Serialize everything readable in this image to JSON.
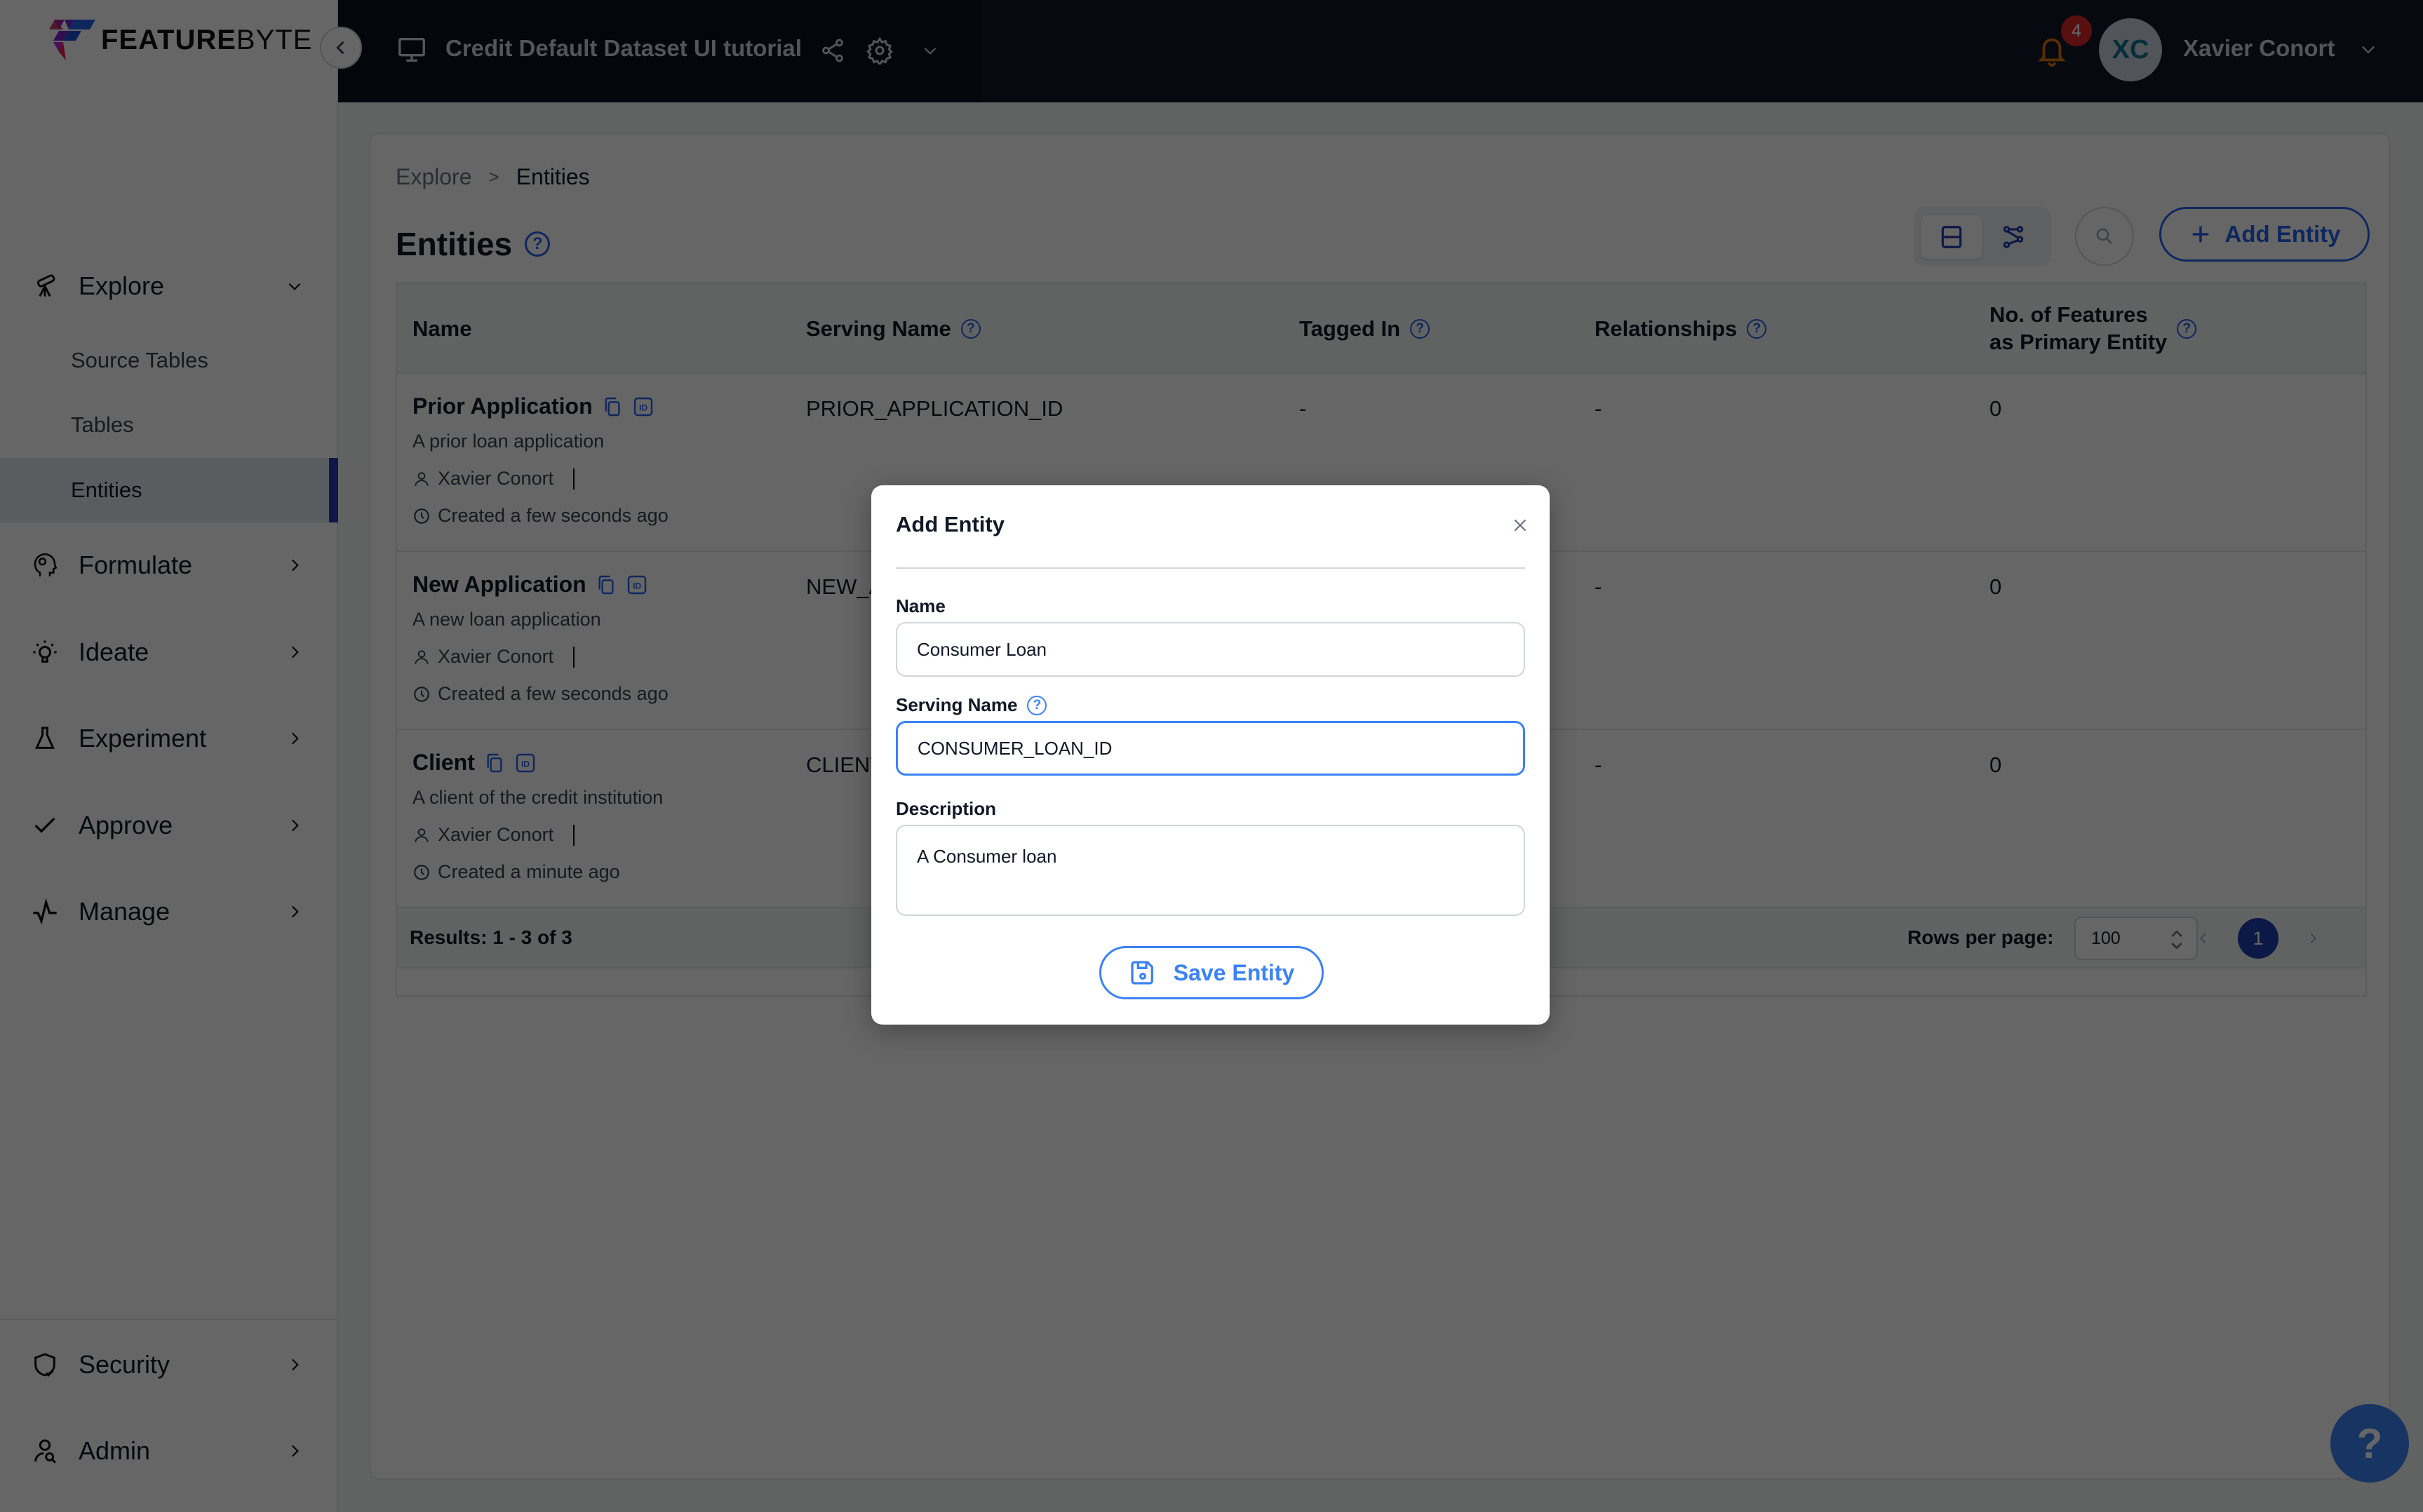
{
  "app": {
    "logo_bold": "FEATURE",
    "logo_light": "BYTE",
    "project_title": "Credit Default Dataset UI tutorial",
    "notification_count": "4",
    "user_initials": "XC",
    "user_name": "Xavier Conort"
  },
  "sidebar": {
    "groups": [
      {
        "label": "Explore",
        "icon": "telescope-icon",
        "expanded": true,
        "items": [
          {
            "label": "Source Tables"
          },
          {
            "label": "Tables"
          },
          {
            "label": "Entities",
            "active": true
          }
        ]
      },
      {
        "label": "Formulate",
        "icon": "head-gear-icon"
      },
      {
        "label": "Ideate",
        "icon": "lightbulb-icon"
      },
      {
        "label": "Experiment",
        "icon": "flask-icon"
      },
      {
        "label": "Approve",
        "icon": "check-icon"
      },
      {
        "label": "Manage",
        "icon": "pulse-icon"
      }
    ],
    "bottom": [
      {
        "label": "Security",
        "icon": "shield-check-icon"
      },
      {
        "label": "Admin",
        "icon": "user-search-icon"
      }
    ]
  },
  "breadcrumb": [
    "Explore",
    "Entities"
  ],
  "page": {
    "title": "Entities",
    "add_button_label": "Add Entity"
  },
  "table": {
    "columns": [
      {
        "label": "Name"
      },
      {
        "label": "Serving Name"
      },
      {
        "label": "Tagged In"
      },
      {
        "label": "Relationships"
      },
      {
        "label": "No. of Features",
        "label2": "as Primary Entity"
      }
    ],
    "rows": [
      {
        "name": "Prior Application",
        "description": "A prior loan application",
        "owner": "Xavier Conort",
        "created": "Created a few seconds ago",
        "serving_name": "PRIOR_APPLICATION_ID",
        "tagged_in": "-",
        "relationships": "-",
        "num_features": "0"
      },
      {
        "name": "New Application",
        "description": "A new loan application",
        "owner": "Xavier Conort",
        "created": "Created a few seconds ago",
        "serving_name": "NEW_APPLICATION_ID",
        "tagged_in": "-",
        "relationships": "-",
        "num_features": "0"
      },
      {
        "name": "Client",
        "description": "A client of the credit institution",
        "owner": "Xavier Conort",
        "created": "Created a minute ago",
        "serving_name": "CLIENT_ID",
        "tagged_in": "-",
        "relationships": "-",
        "num_features": "0"
      }
    ],
    "results_text": "Results: 1 - 3 of 3",
    "rows_per_page_label": "Rows per page:",
    "rows_per_page": "100",
    "current_page": "1"
  },
  "modal": {
    "title": "Add Entity",
    "name_label": "Name",
    "name_value": "Consumer Loan",
    "serving_label": "Serving Name",
    "serving_value": "CONSUMER_LOAN_ID",
    "description_label": "Description",
    "description_value": "A Consumer loan",
    "save_label": "Save Entity"
  },
  "help_fab": "?",
  "colors": {
    "accent": "#2563eb",
    "active_nav": "#1e40af",
    "header_bg": "#111827",
    "badge": "#dc2626",
    "fab": "#3b82f6"
  }
}
